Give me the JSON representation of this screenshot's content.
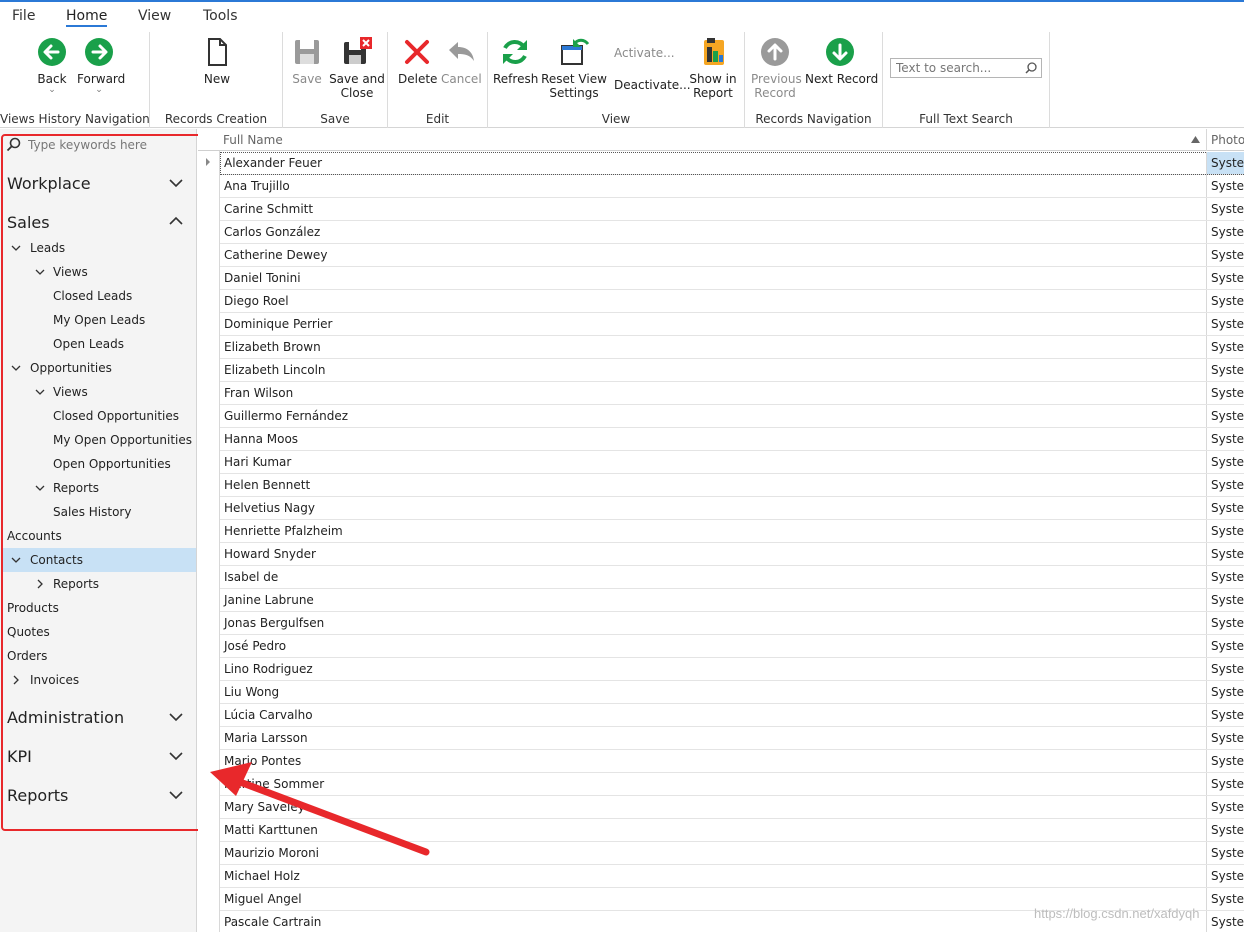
{
  "menu": {
    "file": "File",
    "home": "Home",
    "view": "View",
    "tools": "Tools"
  },
  "ribbon": {
    "groups": {
      "history": "Views History Navigation",
      "creation": "Records Creation",
      "save": "Save",
      "edit": "Edit",
      "view": "View",
      "nav": "Records Navigation",
      "fts": "Full Text Search"
    },
    "back": "Back",
    "forward": "Forward",
    "new": "New",
    "save": "Save",
    "save_close_1": "Save and",
    "save_close_2": "Close",
    "delete": "Delete",
    "cancel": "Cancel",
    "refresh": "Refresh",
    "reset_1": "Reset View",
    "reset_2": "Settings",
    "activate": "Activate...",
    "deactivate": "Deactivate...",
    "show_1": "Show in",
    "show_2": "Report",
    "prev_1": "Previous",
    "prev_2": "Record",
    "next": "Next Record",
    "search_placeholder": "Text to search..."
  },
  "nav": {
    "search_placeholder": "Type keywords here",
    "workplace": "Workplace",
    "sales": "Sales",
    "leads": "Leads",
    "leads_views": "Views",
    "closed_leads": "Closed Leads",
    "my_open_leads": "My Open Leads",
    "open_leads": "Open Leads",
    "opportunities": "Opportunities",
    "opp_views": "Views",
    "closed_opps": "Closed Opportunities",
    "my_open_opps": "My Open Opportunities",
    "open_opps": "Open Opportunities",
    "opp_reports": "Reports",
    "sales_history": "Sales History",
    "accounts": "Accounts",
    "contacts": "Contacts",
    "contacts_reports": "Reports",
    "products": "Products",
    "quotes": "Quotes",
    "orders": "Orders",
    "invoices": "Invoices",
    "administration": "Administration",
    "kpi": "KPI",
    "reports": "Reports"
  },
  "grid": {
    "col_name": "Full Name",
    "col_photo": "Photo",
    "photo_value": "System",
    "rows": [
      "Alexander Feuer",
      "Ana Trujillo",
      "Carine Schmitt",
      "Carlos González",
      "Catherine Dewey",
      "Daniel Tonini",
      "Diego Roel",
      "Dominique Perrier",
      "Elizabeth Brown",
      "Elizabeth Lincoln",
      "Fran Wilson",
      "Guillermo Fernández",
      "Hanna Moos",
      "Hari Kumar",
      "Helen Bennett",
      "Helvetius Nagy",
      "Henriette Pfalzheim",
      "Howard Snyder",
      "Isabel de",
      "Janine Labrune",
      "Jonas Bergulfsen",
      "José Pedro",
      "Lino Rodriguez",
      "Liu Wong",
      "Lúcia Carvalho",
      "Maria Larsson",
      "Mario Pontes",
      "Martine Sommer",
      "Mary Saveley",
      "Matti Karttunen",
      "Maurizio Moroni",
      "Michael Holz",
      "Miguel Angel",
      "Pascale Cartrain"
    ]
  },
  "watermark": "https://blog.csdn.net/xafdyqh",
  "colors": {
    "accent": "#2b79d6",
    "selection": "#c8e1f5",
    "annotation": "#e8282b",
    "green": "#1aa04a"
  }
}
